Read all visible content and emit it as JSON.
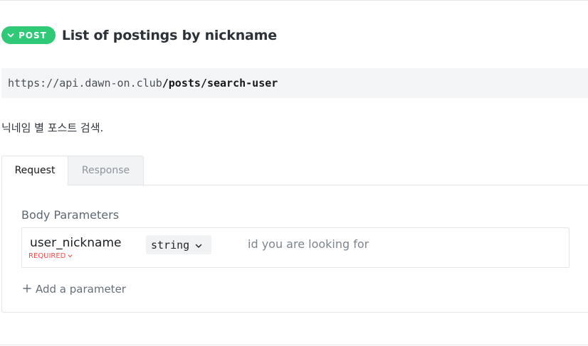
{
  "endpoint": {
    "method": "POST",
    "title": "List of postings by nickname",
    "url_base": "https://api.dawn-on.club",
    "url_path": "/posts/search-user",
    "description": "닉네임 별 포스트 검색."
  },
  "tabs": [
    {
      "label": "Request",
      "active": true
    },
    {
      "label": "Response",
      "active": false
    }
  ],
  "body_parameters": {
    "section_title": "Body Parameters",
    "params": [
      {
        "name": "user_nickname",
        "required_label": "REQUIRED",
        "type": "string",
        "description": "id you are looking for"
      }
    ],
    "add_label": "Add a parameter"
  },
  "colors": {
    "method_badge": "#2fc977",
    "required": "#f05050"
  },
  "icons": {
    "badge_chevron": "chevron-down-icon",
    "required_chevron": "chevron-down-icon",
    "type_chevron": "chevron-down-icon",
    "add": "plus-icon"
  }
}
